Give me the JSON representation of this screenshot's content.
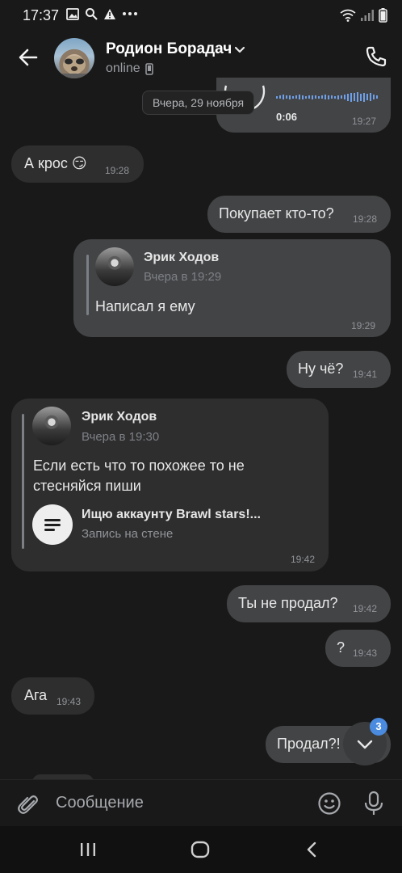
{
  "status_bar": {
    "time": "17:37"
  },
  "header": {
    "name": "Родион Борадач",
    "status": "online"
  },
  "date_separator": "Вчера, 29 ноября",
  "messages": [
    {
      "type": "voice",
      "direction": "out",
      "duration": "0:06",
      "time": "19:27"
    },
    {
      "type": "text",
      "direction": "in",
      "text": "А крос 😏",
      "time": "19:28"
    },
    {
      "type": "text",
      "direction": "out",
      "text": "Покупает кто-то?",
      "time": "19:28"
    },
    {
      "type": "forward",
      "direction": "out",
      "author": "Эрик Ходов",
      "date": "Вчера в 19:29",
      "text": "Написал я ему",
      "time": "19:29"
    },
    {
      "type": "text",
      "direction": "out",
      "text": "Ну чё?",
      "time": "19:41"
    },
    {
      "type": "forward",
      "direction": "in",
      "author": "Эрик Ходов",
      "date": "Вчера в 19:30",
      "text_line1": "Если есть что то похожее то не",
      "text_line2": "стесняйся пиши",
      "wall_title": "Ищю аккаунту Brawl stars!...",
      "wall_subtitle": "Запись на стене",
      "time": "19:42"
    },
    {
      "type": "text",
      "direction": "out",
      "text": "Ты не продал?",
      "time": "19:42"
    },
    {
      "type": "text",
      "direction": "out",
      "text": "?",
      "time": "19:43"
    },
    {
      "type": "text",
      "direction": "in",
      "text": "Ага",
      "time": "19:43"
    },
    {
      "type": "text",
      "direction": "out",
      "text": "Продал?!",
      "time": ""
    }
  ],
  "scroll_down": {
    "unread_count": "3"
  },
  "composer": {
    "placeholder": "Сообщение"
  },
  "colors": {
    "accent": "#4a8be0",
    "incoming_bubble": "#2e2e2f",
    "outgoing_bubble": "#434446",
    "background": "#191919"
  },
  "icons": [
    "back-arrow-icon",
    "chevron-down-icon",
    "phone-icon",
    "attach-icon",
    "emoji-icon",
    "microphone-icon",
    "document-icon",
    "chevron-down-icon",
    "recent-apps-icon",
    "home-icon",
    "back-icon"
  ]
}
